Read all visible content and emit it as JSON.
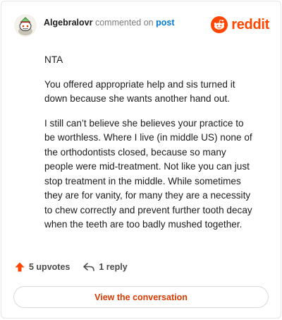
{
  "header": {
    "author": "Algebralovr",
    "action_text": "commented on",
    "post_link_label": "post",
    "brand_wordmark": "reddit",
    "brand_color": "#ff4500"
  },
  "comment": {
    "paragraphs": [
      "NTA",
      "You offered appropriate help and sis turned it down because she wants another hand out.",
      "I still can’t believe she believes your practice to be worthless. Where I live (in middle US) none of the orthodontists closed, because so many people were mid-treatment. Not like you can just stop treatment in the middle. While sometimes they are for vanity, for many they are a necessity to chew correctly and prevent further tooth decay when the teeth are too badly mushed together."
    ]
  },
  "footer": {
    "upvotes_label": "5 upvotes",
    "replies_label": "1 reply",
    "upvote_icon": "upvote-arrow-icon",
    "reply_icon": "reply-arrow-icon",
    "view_button_label": "View the conversation"
  }
}
